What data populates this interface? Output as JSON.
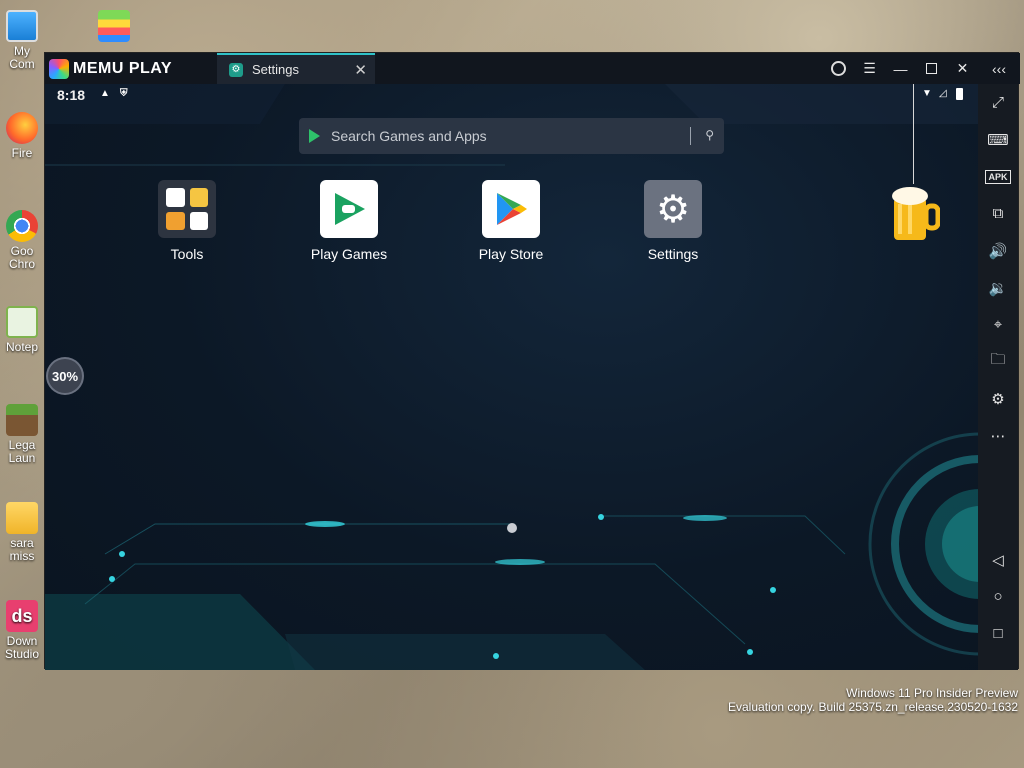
{
  "desktop": {
    "icons": [
      {
        "name": "my-computer",
        "label": "My Com"
      },
      {
        "name": "firefox",
        "label": "Fire"
      },
      {
        "name": "chrome",
        "label": "Goo\nChro"
      },
      {
        "name": "notepad",
        "label": "Notep"
      },
      {
        "name": "legacy-launcher",
        "label": "Lega\nLaun"
      },
      {
        "name": "folder",
        "label": "sara\nmiss"
      },
      {
        "name": "download-studio",
        "label": "Down\nStudio"
      }
    ],
    "watermark_line1": "Windows 11 Pro Insider Preview",
    "watermark_line2": "Evaluation copy. Build 25375.zn_release.230520-1632"
  },
  "window": {
    "brand": "MEMU PLAY",
    "tab_label": "Settings"
  },
  "android": {
    "time": "8:18",
    "search_placeholder": "Search Games and Apps",
    "apps": [
      {
        "label": "Tools"
      },
      {
        "label": "Play Games"
      },
      {
        "label": "Play Store"
      },
      {
        "label": "Settings"
      }
    ],
    "progress_value": "30%"
  },
  "toolbar": {
    "items": [
      "fullscreen",
      "keyboard",
      "APK",
      "multi-window",
      "volume-up",
      "volume-down",
      "location",
      "folder",
      "settings",
      "more"
    ],
    "apk_label": "APK"
  },
  "colors": {
    "accent": "#2fc2c8",
    "window_bg": "#0d1622",
    "titlebar": "#11161e",
    "toolbar": "#161b22"
  }
}
